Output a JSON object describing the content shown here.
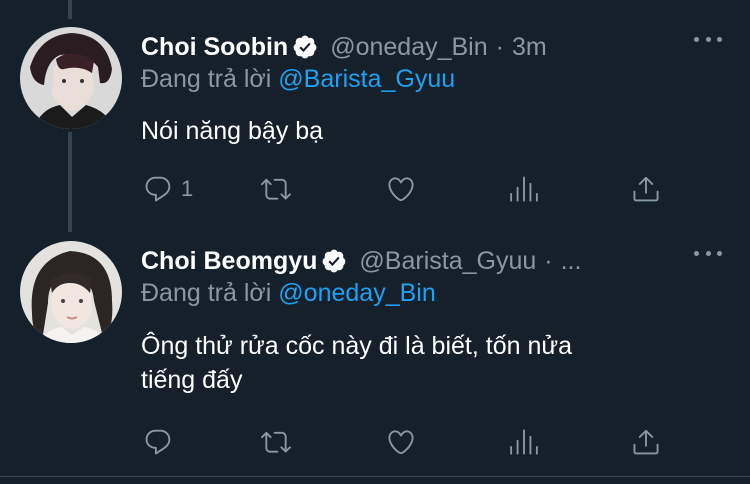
{
  "tweets": [
    {
      "author_name": "Choi Soobin",
      "author_handle": "@oneday_Bin",
      "separator": "·",
      "timestamp": "3m",
      "verified_icon": "verified-badge-icon",
      "reply_prefix": "Đang trả lời",
      "reply_to": "@Barista_Gyuu",
      "text": "Nói năng bậy bạ",
      "reply_count": "1",
      "retweet_count": "",
      "like_count": ""
    },
    {
      "author_name": "Choi Beomgyu",
      "author_handle": "@Barista_Gyuu",
      "separator": "·",
      "timestamp": "...",
      "verified_icon": "verified-badge-icon",
      "reply_prefix": "Đang trả lời",
      "reply_to": "@oneday_Bin",
      "text_line1": "Ông thử rửa cốc này đi là biết, tốn nửa",
      "text_line2": "tiếng đấy",
      "reply_count": "",
      "retweet_count": "",
      "like_count": ""
    }
  ],
  "colors": {
    "background": "#15202b",
    "primary_text": "#ffffff",
    "secondary_text": "#8899a6",
    "link": "#1da1f2",
    "divider": "#38444d"
  },
  "icons": [
    "reply-icon",
    "retweet-icon",
    "like-icon",
    "analytics-icon",
    "share-icon",
    "more-icon",
    "verified-badge-icon"
  ]
}
